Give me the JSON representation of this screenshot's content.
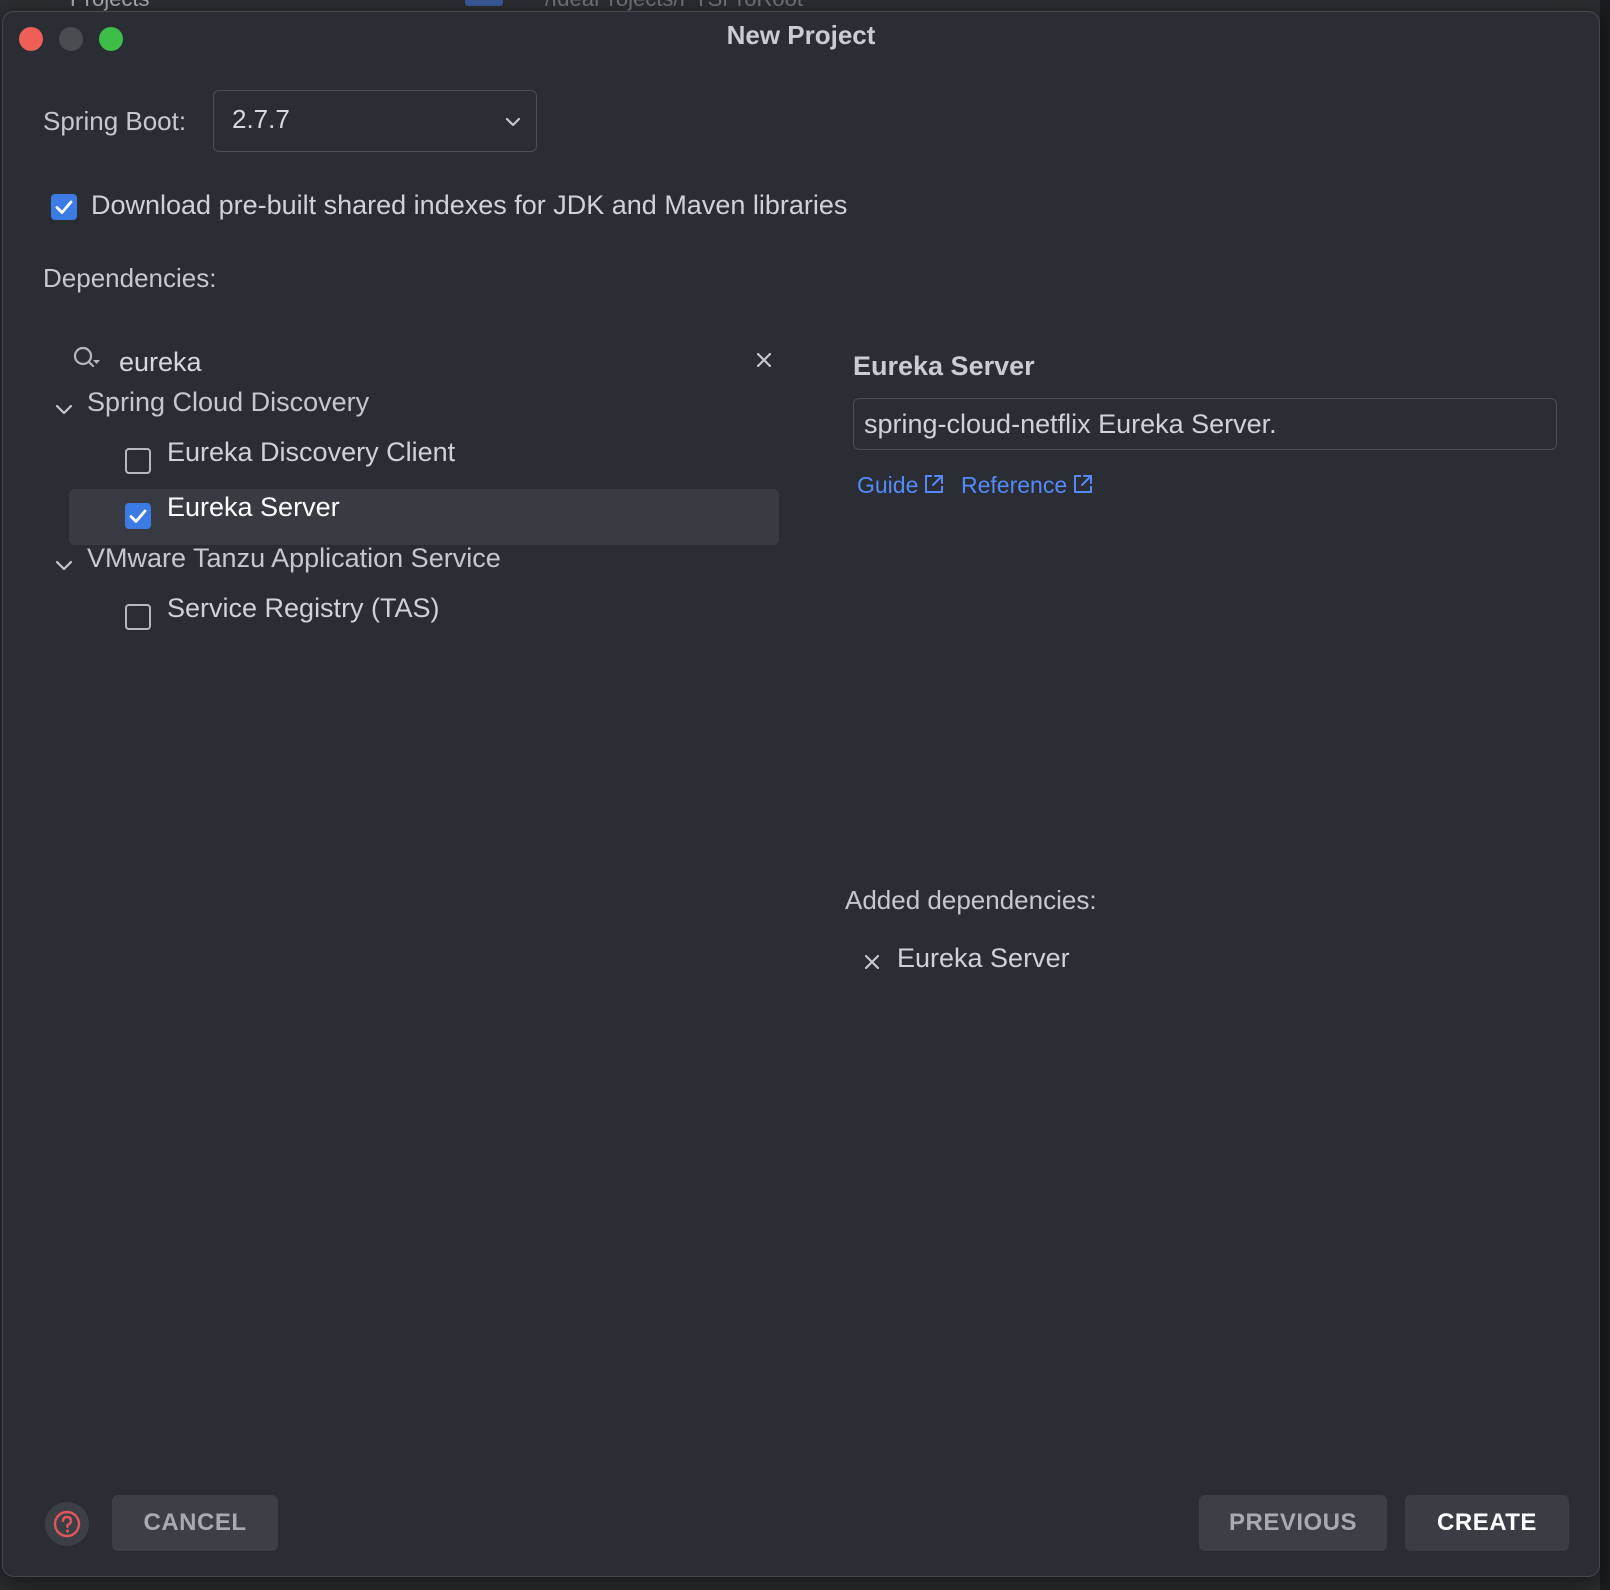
{
  "background": {
    "projects_label": "Projects",
    "path_text": "/IdeaProjects/PTSProRoot"
  },
  "window": {
    "title": "New Project"
  },
  "spring_boot": {
    "label": "Spring Boot:",
    "selected_version": "2.7.7"
  },
  "download_indexes": {
    "label": "Download pre-built shared indexes for JDK and Maven libraries",
    "checked": true
  },
  "dependencies": {
    "label": "Dependencies:",
    "search": {
      "value": "eureka",
      "placeholder": ""
    },
    "groups": [
      {
        "name": "Spring Cloud Discovery",
        "expanded": true,
        "items": [
          {
            "label": "Eureka Discovery Client",
            "checked": false
          },
          {
            "label": "Eureka Server",
            "checked": true,
            "selected": true
          }
        ]
      },
      {
        "name": "VMware Tanzu Application Service",
        "expanded": true,
        "items": [
          {
            "label": "Service Registry (TAS)",
            "checked": false
          }
        ]
      }
    ]
  },
  "detail": {
    "title": "Eureka Server",
    "description": "spring-cloud-netflix Eureka Server.",
    "links": {
      "guide": "Guide",
      "reference": "Reference"
    }
  },
  "added_dependencies": {
    "label": "Added dependencies:",
    "items": [
      "Eureka Server"
    ]
  },
  "footer": {
    "cancel": "CANCEL",
    "previous": "PREVIOUS",
    "create": "CREATE"
  },
  "colors": {
    "accent": "#3d7be4",
    "link": "#548af7",
    "dialog_bg": "#2b2d35",
    "close_light": "#ee5f57",
    "max_light": "#3ebe48",
    "help_icon": "#e0575b"
  }
}
